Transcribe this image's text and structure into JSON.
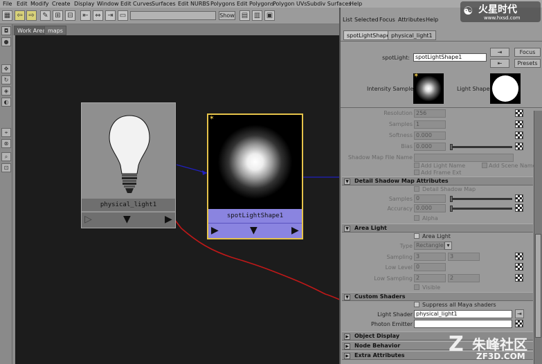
{
  "menubar": {
    "items": [
      "File",
      "Edit",
      "Modify",
      "Create",
      "Display",
      "Window",
      "Edit Curves",
      "Surfaces",
      "Edit NURBS",
      "Polygons",
      "Edit Polygons",
      "Polygon UVs",
      "Subdiv Surfaces",
      "Help"
    ]
  },
  "toolbar": {
    "show_label": "Show"
  },
  "graph": {
    "tabs": [
      "Work Area",
      "maps"
    ],
    "physical_node_label": "physical_light1",
    "spot_node_label": "spotLightShape1"
  },
  "attr_editor": {
    "menu": [
      "List",
      "Selected",
      "Focus",
      "Attributes",
      "Help"
    ],
    "tabs": [
      "spotLightShape1",
      "physical_light1"
    ],
    "node_type_label": "spotLight:",
    "node_name": "spotLightShape1",
    "focus_label": "Focus",
    "presets_label": "Presets",
    "intensity_sample_label": "Intensity Sample",
    "light_shape_label": "Light Shape",
    "shadow_rows": [
      {
        "label": "Resolution",
        "value": "256"
      },
      {
        "label": "Samples",
        "value": "1"
      },
      {
        "label": "Softness",
        "value": "0.000"
      },
      {
        "label": "Bias",
        "value": "0.000"
      }
    ],
    "shadow_map_file_name_label": "Shadow Map File Name",
    "add_light_name": "Add Light Name",
    "add_scene_name": "Add Scene Name",
    "add_frame_ext": "Add Frame Ext",
    "sections": {
      "detail_shadow": "Detail Shadow Map Attributes",
      "area_light": "Area Light",
      "custom_shaders": "Custom Shaders",
      "object_display": "Object Display",
      "node_behavior": "Node Behavior",
      "extra_attributes": "Extra Attributes"
    },
    "detail_shadow_map_chk": "Detail Shadow Map",
    "detail_samples_label": "Samples",
    "detail_samples_value": "0",
    "detail_accuracy_label": "Accuracy",
    "detail_accuracy_value": "0.000",
    "alpha_label": "Alpha",
    "area_light_chk": "Area Light",
    "type_label": "Type",
    "type_value": "Rectangle",
    "sampling_label": "Sampling",
    "sampling_values": [
      "3",
      "3"
    ],
    "low_level_label": "Low Level",
    "low_level_value": "0",
    "low_sampling_label": "Low Sampling",
    "low_sampling_values": [
      "2",
      "2"
    ],
    "visible_label": "Visible",
    "suppress_label": "Suppress all Maya shaders",
    "light_shader_label": "Light Shader",
    "light_shader_value": "physical_light1",
    "photon_emitter_label": "Photon Emitter",
    "photon_emitter_value": ""
  },
  "watermarks": {
    "top_brand": "火星时代",
    "top_url": "www.hxsd.com",
    "bottom_brand": "朱峰社区",
    "bottom_url": "ZF3D.COM"
  },
  "colors": {
    "selected_node": "#8a84e0",
    "selected_border": "#e6c34a",
    "connection_line": "#c01818",
    "link_arrow": "#2020c0"
  }
}
